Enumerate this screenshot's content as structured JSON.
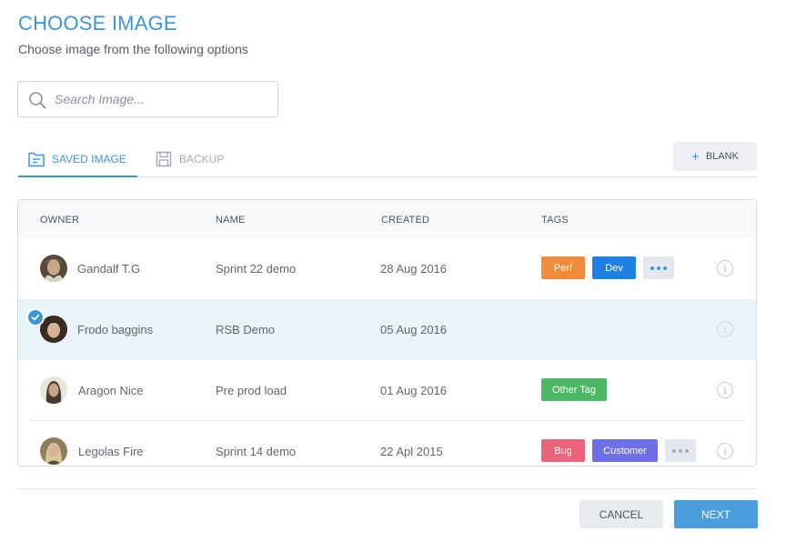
{
  "header": {
    "title": "CHOOSE IMAGE",
    "subtitle": "Choose image from the following options"
  },
  "search": {
    "placeholder": "Search Image...",
    "value": ""
  },
  "tabs": [
    {
      "label": "SAVED IMAGE",
      "active": true,
      "icon": "folder-icon"
    },
    {
      "label": "BACKUP",
      "active": false,
      "icon": "save-icon"
    }
  ],
  "blank_button": {
    "label": "BLANK",
    "icon": "plus-icon"
  },
  "table": {
    "columns": [
      "OWNER",
      "NAME",
      "CREATED",
      "TAGS"
    ],
    "rows": [
      {
        "owner": "Gandalf T.G",
        "name": "Sprint 22 demo",
        "created": "28 Aug 2016",
        "selected": false,
        "tags": [
          {
            "label": "Perf",
            "color": "#ef8b3a"
          },
          {
            "label": "Dev",
            "color": "#1e80e0"
          }
        ],
        "more": true
      },
      {
        "owner": "Frodo baggins",
        "name": "RSB Demo",
        "created": "05 Aug 2016",
        "selected": true,
        "tags": [],
        "more": false
      },
      {
        "owner": "Aragon Nice",
        "name": "Pre prod load",
        "created": "01 Aug 2016",
        "selected": false,
        "tags": [
          {
            "label": "Other Tag",
            "color": "#4cb865"
          }
        ],
        "more": false
      },
      {
        "owner": "Legolas Fire",
        "name": "Sprint 14 demo",
        "created": "22 Apl 2015",
        "selected": false,
        "tags": [
          {
            "label": "Bug",
            "color": "#ea6378"
          },
          {
            "label": "Customer",
            "color": "#6e6ee8"
          }
        ],
        "more": true
      }
    ]
  },
  "footer": {
    "cancel_label": "CANCEL",
    "next_label": "NEXT"
  },
  "colors": {
    "accent": "#3d95d9",
    "selected_row": "#e8f4f8",
    "primary_button": "#4a9ede"
  }
}
